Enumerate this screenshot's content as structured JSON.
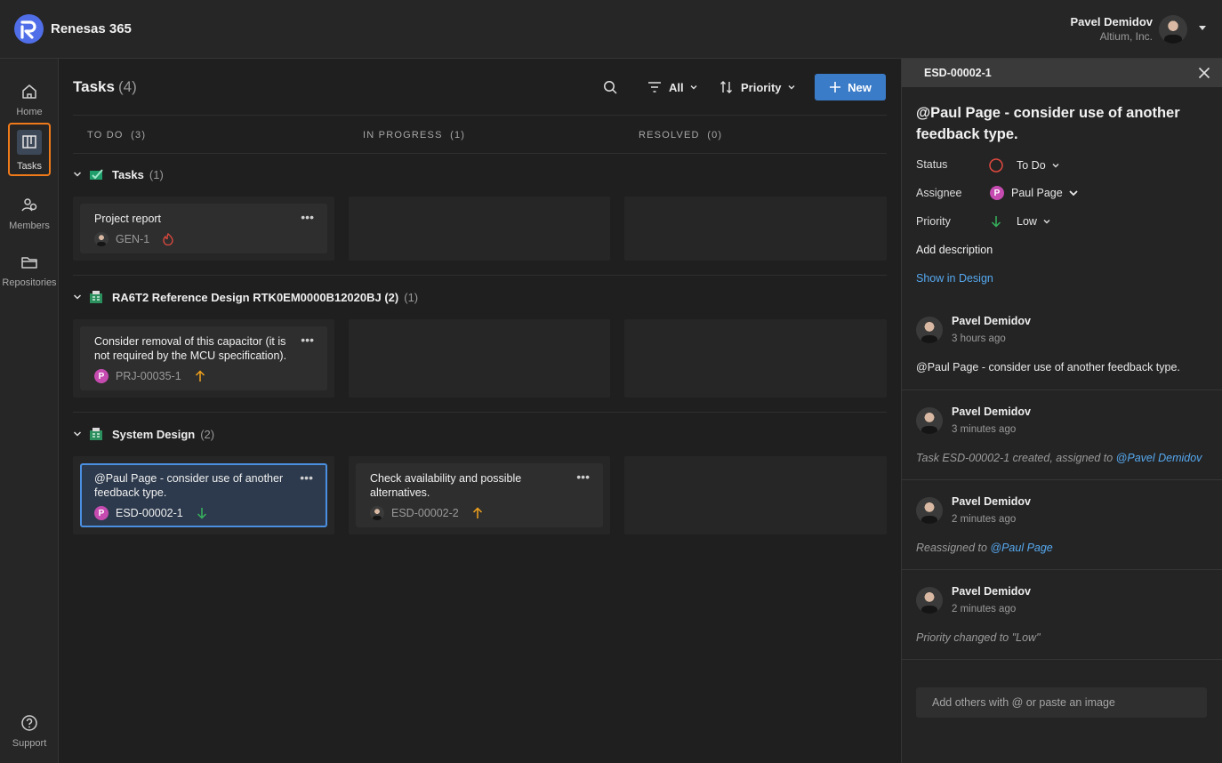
{
  "app": {
    "brand": "Renesas 365",
    "accent": "#3b7cc9",
    "highlight": "#f07a1a"
  },
  "user": {
    "name": "Pavel Demidov",
    "org": "Altium, Inc."
  },
  "sidebar": {
    "items": [
      {
        "label": "Home",
        "icon": "home-icon"
      },
      {
        "label": "Tasks",
        "icon": "tasks-icon",
        "active": true
      },
      {
        "label": "Members",
        "icon": "members-icon"
      },
      {
        "label": "Repositories",
        "icon": "folder-icon"
      }
    ],
    "support": "Support"
  },
  "board": {
    "title": "Tasks",
    "count": "(4)",
    "filter_label": "All",
    "sort_label": "Priority",
    "new_label": "New",
    "columns": [
      {
        "label": "TO DO",
        "count": "(3)"
      },
      {
        "label": "IN PROGRESS",
        "count": "(1)"
      },
      {
        "label": "RESOLVED",
        "count": "(0)"
      }
    ],
    "groups": [
      {
        "name": "Tasks",
        "count": "(1)"
      },
      {
        "name": "RA6T2 Reference Design RTK0EM0000B12020BJ (2)",
        "count": "(1)"
      },
      {
        "name": "System Design",
        "count": "(2)"
      }
    ],
    "cards": [
      {
        "title": "Project report",
        "id": "GEN-1",
        "priority": "urgent"
      },
      {
        "title": "Consider removal of this capacitor (it is not required by the MCU specification).",
        "id": "PRJ-00035-1",
        "priority": "high"
      },
      {
        "title": "@Paul Page - consider use of another feedback type.",
        "id": "ESD-00002-1",
        "priority": "low"
      },
      {
        "title": "Check availability and possible alternatives.",
        "id": "ESD-00002-2",
        "priority": "high"
      }
    ],
    "card_menu": "•••"
  },
  "panel": {
    "id": "ESD-00002-1",
    "title": "@Paul Page - consider use of another feedback type.",
    "status_label": "Status",
    "status_value": "To Do",
    "assignee_label": "Assignee",
    "assignee_value": "Paul Page",
    "assignee_initial": "P",
    "priority_label": "Priority",
    "priority_value": "Low",
    "add_description": "Add description",
    "show_in_design": "Show in Design",
    "activity": [
      {
        "author": "Pavel Demidov",
        "time": "3 hours ago",
        "text": "@Paul Page - consider use of another feedback type."
      },
      {
        "author": "Pavel Demidov",
        "time": "3 minutes ago",
        "text": "Task ESD-00002-1 created, assigned to ",
        "mention": "@Pavel Demidov"
      },
      {
        "author": "Pavel Demidov",
        "time": "2 minutes ago",
        "text": "Reassigned to ",
        "mention": "@Paul Page"
      },
      {
        "author": "Pavel Demidov",
        "time": "2 minutes ago",
        "text": "Priority changed to \"Low\""
      }
    ],
    "composer_placeholder": "Add others with @ or paste an image"
  }
}
